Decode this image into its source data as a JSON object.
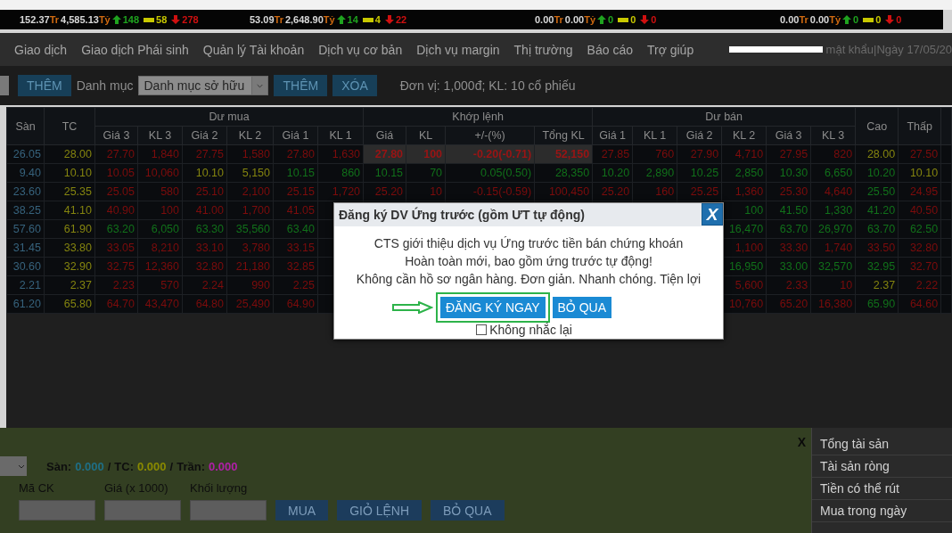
{
  "ticker": [
    {
      "value": "152.37",
      "value_unit": "Tr",
      "total": "4,585.13",
      "total_unit": "Tỷ",
      "up": "148",
      "flat": "58",
      "down": "278"
    },
    {
      "value": "53.09",
      "value_unit": "Tr",
      "total": "2,648.90",
      "total_unit": "Tỷ",
      "up": "14",
      "flat": "4",
      "down": "22"
    },
    {
      "value": "0.00",
      "value_unit": "Tr",
      "total": "0.00",
      "total_unit": "Tỷ",
      "up": "0",
      "flat": "0",
      "down": "0"
    },
    {
      "value": "0.00",
      "value_unit": "Tr",
      "total": "0.00",
      "total_unit": "Tỷ",
      "up": "0",
      "flat": "0",
      "down": "0"
    }
  ],
  "nav": {
    "items": [
      "Giao dịch",
      "Giao dịch Phái sinh",
      "Quản lý Tài khoản",
      "Dịch vụ cơ bản",
      "Dịch vụ margin",
      "Thị trường",
      "Báo cáo",
      "Trợ giúp"
    ],
    "user_info": "mật khẩu|Ngày 17/05/20"
  },
  "toolbar": {
    "add_label": "THÊM",
    "list_label": "Danh mục",
    "list_value": "Danh mục sở hữu",
    "buttons": [
      "THÊM",
      "XÓA"
    ],
    "note": "Đơn vị: 1,000đ; KL: 10 cổ phiếu"
  },
  "table": {
    "leading_columns": [
      "Sàn",
      "TC"
    ],
    "groups": [
      {
        "label": "Dư mua",
        "columns": [
          "Giá 3",
          "KL 3",
          "Giá 2",
          "KL 2",
          "Giá 1",
          "KL 1"
        ]
      },
      {
        "label": "Khớp lệnh",
        "columns": [
          "Giá",
          "KL",
          "+/-(%)",
          "Tổng KL"
        ]
      },
      {
        "label": "Dư bán",
        "columns": [
          "Giá 1",
          "KL 1",
          "Giá 2",
          "KL 2",
          "Giá 3",
          "KL 3"
        ]
      }
    ],
    "trailing_columns": [
      "Cao",
      "Thấp"
    ],
    "rows": [
      {
        "floor": "26.05",
        "reference": "28.00",
        "highlighted": true,
        "cells": [
          {
            "text": "27.70",
            "color": "#7c0c0c"
          },
          {
            "text": "1,840",
            "color": "#7c0c0c"
          },
          {
            "text": "27.75",
            "color": "#7c0c0c"
          },
          {
            "text": "1,580",
            "color": "#7c0c0c"
          },
          {
            "text": "27.80",
            "color": "#7c0c0c"
          },
          {
            "text": "1,630",
            "color": "#7c0c0c"
          },
          {
            "text": "27.80",
            "color": "#9a1414"
          },
          {
            "text": "100",
            "color": "#9a1414"
          },
          {
            "text": "-0.20(-0.71)",
            "color": "#9a1414"
          },
          {
            "text": "52,150",
            "color": "#9a1414"
          },
          {
            "text": "27.85",
            "color": "#7c0c0c"
          },
          {
            "text": "760",
            "color": "#7c0c0c"
          },
          {
            "text": "27.90",
            "color": "#7c0c0c"
          },
          {
            "text": "4,710",
            "color": "#7c0c0c"
          },
          {
            "text": "27.95",
            "color": "#7c0c0c"
          },
          {
            "text": "820",
            "color": "#7c0c0c"
          },
          {
            "text": "28.00",
            "color": "#84840f"
          },
          {
            "text": "27.50",
            "color": "#7c0c0c"
          }
        ]
      },
      {
        "floor": "9.40",
        "reference": "10.10",
        "highlighted": false,
        "cells": [
          {
            "text": "10.05",
            "color": "#7c0c0c"
          },
          {
            "text": "10,060",
            "color": "#7c0c0c"
          },
          {
            "text": "10.10",
            "color": "#84840f"
          },
          {
            "text": "5,150",
            "color": "#84840f"
          },
          {
            "text": "10.15",
            "color": "#11701a"
          },
          {
            "text": "860",
            "color": "#11701a"
          },
          {
            "text": "10.15",
            "color": "#11701a"
          },
          {
            "text": "70",
            "color": "#11701a"
          },
          {
            "text": "0.05(0.50)",
            "color": "#11701a"
          },
          {
            "text": "28,350",
            "color": "#11701a"
          },
          {
            "text": "10.20",
            "color": "#11701a"
          },
          {
            "text": "2,890",
            "color": "#11701a"
          },
          {
            "text": "10.25",
            "color": "#11701a"
          },
          {
            "text": "2,850",
            "color": "#11701a"
          },
          {
            "text": "10.30",
            "color": "#11701a"
          },
          {
            "text": "6,650",
            "color": "#11701a"
          },
          {
            "text": "10.20",
            "color": "#11701a"
          },
          {
            "text": "10.10",
            "color": "#84840f"
          }
        ]
      },
      {
        "floor": "23.60",
        "reference": "25.35",
        "highlighted": false,
        "cells": [
          {
            "text": "25.05",
            "color": "#7c0c0c"
          },
          {
            "text": "580",
            "color": "#7c0c0c"
          },
          {
            "text": "25.10",
            "color": "#7c0c0c"
          },
          {
            "text": "2,100",
            "color": "#7c0c0c"
          },
          {
            "text": "25.15",
            "color": "#7c0c0c"
          },
          {
            "text": "1,720",
            "color": "#7c0c0c"
          },
          {
            "text": "25.20",
            "color": "#7c0c0c"
          },
          {
            "text": "10",
            "color": "#7c0c0c"
          },
          {
            "text": "-0.15(-0.59)",
            "color": "#7c0c0c"
          },
          {
            "text": "100,450",
            "color": "#7c0c0c"
          },
          {
            "text": "25.20",
            "color": "#7c0c0c"
          },
          {
            "text": "160",
            "color": "#7c0c0c"
          },
          {
            "text": "25.25",
            "color": "#7c0c0c"
          },
          {
            "text": "1,360",
            "color": "#7c0c0c"
          },
          {
            "text": "25.30",
            "color": "#7c0c0c"
          },
          {
            "text": "4,640",
            "color": "#7c0c0c"
          },
          {
            "text": "25.50",
            "color": "#11701a"
          },
          {
            "text": "24.95",
            "color": "#7c0c0c"
          }
        ]
      },
      {
        "floor": "38.25",
        "reference": "41.10",
        "cells": [
          {
            "text": "40.90",
            "color": "#7c0c0c"
          },
          {
            "text": "100",
            "color": "#7c0c0c"
          },
          {
            "text": "41.00",
            "color": "#7c0c0c"
          },
          {
            "text": "1,700",
            "color": "#7c0c0c"
          },
          {
            "text": "41.05",
            "color": "#7c0c0c"
          },
          null,
          null,
          null,
          null,
          null,
          null,
          null,
          null,
          {
            "text": "100",
            "color": "#11701a"
          },
          {
            "text": "41.50",
            "color": "#11701a"
          },
          {
            "text": "1,330",
            "color": "#11701a"
          },
          {
            "text": "41.20",
            "color": "#11701a"
          },
          {
            "text": "40.50",
            "color": "#7c0c0c"
          }
        ]
      },
      {
        "floor": "57.60",
        "reference": "61.90",
        "cells": [
          {
            "text": "63.20",
            "color": "#11701a"
          },
          {
            "text": "6,050",
            "color": "#11701a"
          },
          {
            "text": "63.30",
            "color": "#11701a"
          },
          {
            "text": "35,560",
            "color": "#11701a"
          },
          {
            "text": "63.40",
            "color": "#11701a"
          },
          null,
          null,
          null,
          null,
          null,
          null,
          null,
          null,
          {
            "text": "16,470",
            "color": "#11701a"
          },
          {
            "text": "63.70",
            "color": "#11701a"
          },
          {
            "text": "26,970",
            "color": "#11701a"
          },
          {
            "text": "63.70",
            "color": "#11701a"
          },
          {
            "text": "62.50",
            "color": "#11701a"
          }
        ]
      },
      {
        "floor": "31.45",
        "reference": "33.80",
        "cells": [
          {
            "text": "33.05",
            "color": "#7c0c0c"
          },
          {
            "text": "8,210",
            "color": "#7c0c0c"
          },
          {
            "text": "33.10",
            "color": "#7c0c0c"
          },
          {
            "text": "3,780",
            "color": "#7c0c0c"
          },
          {
            "text": "33.15",
            "color": "#7c0c0c"
          },
          null,
          null,
          null,
          null,
          null,
          null,
          null,
          null,
          {
            "text": "1,100",
            "color": "#7c0c0c"
          },
          {
            "text": "33.30",
            "color": "#7c0c0c"
          },
          {
            "text": "1,740",
            "color": "#7c0c0c"
          },
          {
            "text": "33.50",
            "color": "#7c0c0c"
          },
          {
            "text": "32.80",
            "color": "#7c0c0c"
          }
        ]
      },
      {
        "floor": "30.60",
        "reference": "32.90",
        "cells": [
          {
            "text": "32.75",
            "color": "#7c0c0c"
          },
          {
            "text": "12,360",
            "color": "#7c0c0c"
          },
          {
            "text": "32.80",
            "color": "#7c0c0c"
          },
          {
            "text": "21,180",
            "color": "#7c0c0c"
          },
          {
            "text": "32.85",
            "color": "#7c0c0c"
          },
          null,
          null,
          null,
          null,
          null,
          null,
          null,
          null,
          {
            "text": "16,950",
            "color": "#11701a"
          },
          {
            "text": "33.00",
            "color": "#11701a"
          },
          {
            "text": "32,570",
            "color": "#11701a"
          },
          {
            "text": "32.95",
            "color": "#11701a"
          },
          {
            "text": "32.70",
            "color": "#7c0c0c"
          }
        ]
      },
      {
        "floor": "2.21",
        "reference": "2.37",
        "cells": [
          {
            "text": "2.23",
            "color": "#7c0c0c"
          },
          {
            "text": "570",
            "color": "#7c0c0c"
          },
          {
            "text": "2.24",
            "color": "#7c0c0c"
          },
          {
            "text": "990",
            "color": "#7c0c0c"
          },
          {
            "text": "2.25",
            "color": "#7c0c0c"
          },
          null,
          null,
          null,
          null,
          null,
          null,
          null,
          null,
          {
            "text": "5,600",
            "color": "#7c0c0c"
          },
          {
            "text": "2.33",
            "color": "#7c0c0c"
          },
          {
            "text": "10",
            "color": "#7c0c0c"
          },
          {
            "text": "2.37",
            "color": "#84840f"
          },
          {
            "text": "2.22",
            "color": "#7c0c0c"
          }
        ]
      },
      {
        "floor": "61.20",
        "reference": "65.80",
        "cells": [
          {
            "text": "64.70",
            "color": "#7c0c0c"
          },
          {
            "text": "43,470",
            "color": "#7c0c0c"
          },
          {
            "text": "64.80",
            "color": "#7c0c0c"
          },
          {
            "text": "25,490",
            "color": "#7c0c0c"
          },
          {
            "text": "64.90",
            "color": "#7c0c0c"
          },
          null,
          null,
          null,
          null,
          null,
          null,
          null,
          null,
          {
            "text": "10,760",
            "color": "#7c0c0c"
          },
          {
            "text": "65.20",
            "color": "#7c0c0c"
          },
          {
            "text": "16,380",
            "color": "#7c0c0c"
          },
          {
            "text": "65.90",
            "color": "#11701a"
          },
          {
            "text": "64.60",
            "color": "#7c0c0c"
          }
        ]
      }
    ]
  },
  "order_panel": {
    "close": "X",
    "separator": "/",
    "prices": [
      {
        "label": "Sàn:",
        "value": "0.000",
        "kind": "floor"
      },
      {
        "label": "TC:",
        "value": "0.000",
        "kind": "ref"
      },
      {
        "label": "Trần:",
        "value": "0.000",
        "kind": "ceiling"
      }
    ],
    "fields": [
      "Mã CK",
      "Giá (x 1000)",
      "Khối lượng"
    ],
    "buttons": [
      "MUA",
      "GIỎ LỆNH",
      "BỎ QUA"
    ]
  },
  "account_summary": [
    "Tổng tài sản",
    "Tài sản ròng",
    "Tiền có thể rút",
    "Mua trong ngày"
  ],
  "modal": {
    "title": "Đăng ký DV Ứng trước (gồm ƯT tự động)",
    "close": "X",
    "lines": [
      "CTS giới thiệu dịch vụ Ứng trước tiền bán chứng khoán",
      "Hoàn toàn mới, bao gồm ứng trước tự động!",
      "Không cần hồ sơ ngân hàng. Đơn giản. Nhanh chóng. Tiện lợi"
    ],
    "buttons": [
      {
        "label": "ĐĂNG KÝ NGAY",
        "highlighted": true
      },
      {
        "label": "BỎ QUA",
        "highlighted": false
      }
    ],
    "checkbox": {
      "label": "Không nhắc lại",
      "checked": false
    }
  }
}
